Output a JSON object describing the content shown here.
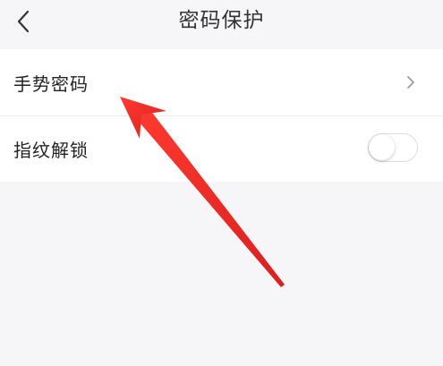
{
  "header": {
    "title": "密码保护",
    "back_icon": "chevron-left-icon"
  },
  "settings": {
    "gesture": {
      "label": "手势密码",
      "icon": "chevron-right-icon"
    },
    "fingerprint": {
      "label": "指纹解锁",
      "toggle_on": false
    }
  },
  "annotation": {
    "arrow_color": "#e53935"
  }
}
